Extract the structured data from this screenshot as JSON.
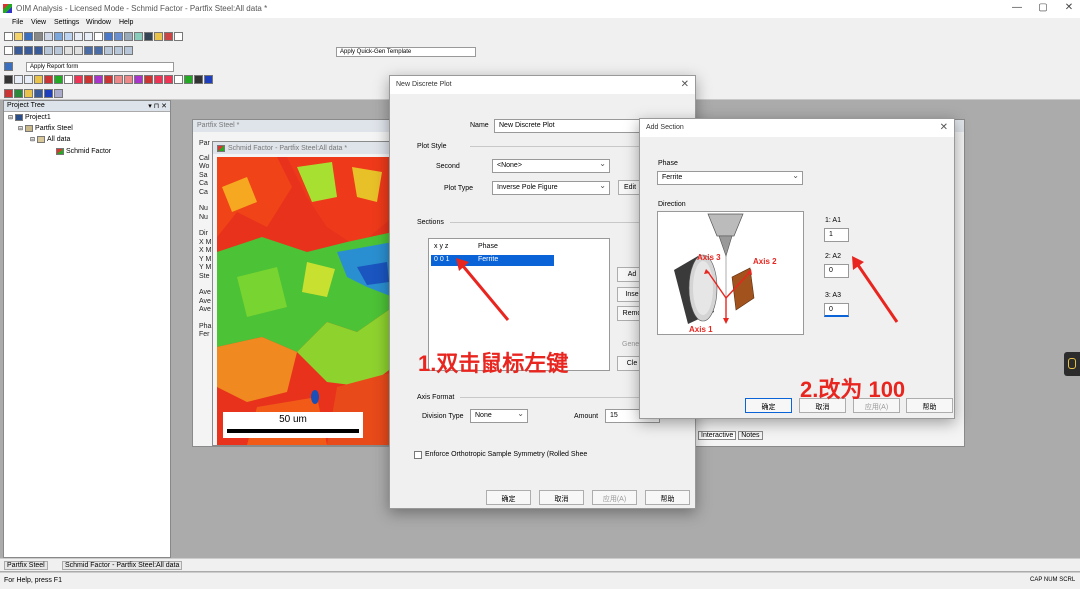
{
  "app": {
    "title": "OIM Analysis - Licensed Mode - Schmid Factor - Partfix Steel:All data *",
    "minimize": "—",
    "maximize": "▢",
    "close": "✕"
  },
  "menu": [
    "File",
    "View",
    "Settings",
    "Window",
    "Help"
  ],
  "toolbar": {
    "quick_gen": "Apply Quick-Gen Template",
    "report_form": "Apply Report form"
  },
  "tree": {
    "header": "Project Tree",
    "header_controls": "▾ ⊓ ✕",
    "items": [
      "Project1",
      "Partfix Steel",
      "All data",
      "Schmid Factor"
    ]
  },
  "bg_window": {
    "title": "Partfix Steel *",
    "labels": [
      "Par",
      "Cal",
      "Wo",
      "Sa",
      "Ca",
      "Ca",
      "Nu",
      "Nu",
      "Dir",
      "X M",
      "X M",
      "Y M",
      "Y M",
      "Ste",
      "Ave",
      "Ave",
      "Ave",
      "Pha",
      "Fer"
    ],
    "tabs": [
      "Interactive",
      "Notes"
    ]
  },
  "map_window": {
    "title": "Schmid Factor - Partfix Steel:All data *",
    "scale_bar": "50 um"
  },
  "discrete_plot": {
    "title": "New Discrete Plot",
    "name_label": "Name",
    "name_value": "New Discrete Plot",
    "plot_style_label": "Plot Style",
    "second_label": "Second",
    "second_value": "<None>",
    "plot_type_label": "Plot Type",
    "plot_type_value": "Inverse Pole Figure",
    "edit_button": "Edit",
    "sections_label": "Sections",
    "col_xyz": "x y z",
    "col_phase": "Phase",
    "row_xyz": "0 0 1",
    "row_phase": "Ferrite",
    "side_buttons": [
      "Ad",
      "Inse",
      "Remo",
      "Gene",
      "Cle"
    ],
    "axis_format_label": "Axis Format",
    "division_type_label": "Division Type",
    "division_type_value": "None",
    "amount_label": "Amount",
    "amount_value": "15",
    "enforce_label": "Enforce Orthotropic Sample Symmetry (Rolled Shee",
    "ok": "确定",
    "cancel": "取消",
    "apply": "应用(A)",
    "help": "帮助"
  },
  "add_section": {
    "title": "Add Section",
    "phase_label": "Phase",
    "phase_value": "Ferrite",
    "direction_label": "Direction",
    "a1_label": "1: A1",
    "a1_value": "1",
    "a2_label": "2: A2",
    "a2_value": "0",
    "a3_label": "3: A3",
    "a3_value": "0",
    "axis1": "Axis 1",
    "axis2": "Axis 2",
    "axis3": "Axis 3",
    "ok": "确定",
    "cancel": "取消",
    "apply": "应用(A)",
    "help": "帮助"
  },
  "annotations": {
    "step1": "1.双击鼠标左键",
    "step2": "2.改为 100"
  },
  "taskbar": [
    "Partfix Steel",
    "Schmid Factor - Partfix Steel:All data"
  ],
  "status": {
    "left": "For Help, press F1",
    "right": "CAP NUM SCRL"
  },
  "colors": {
    "annotation_red": "#e8251f",
    "selection_blue": "#0a64d8"
  }
}
